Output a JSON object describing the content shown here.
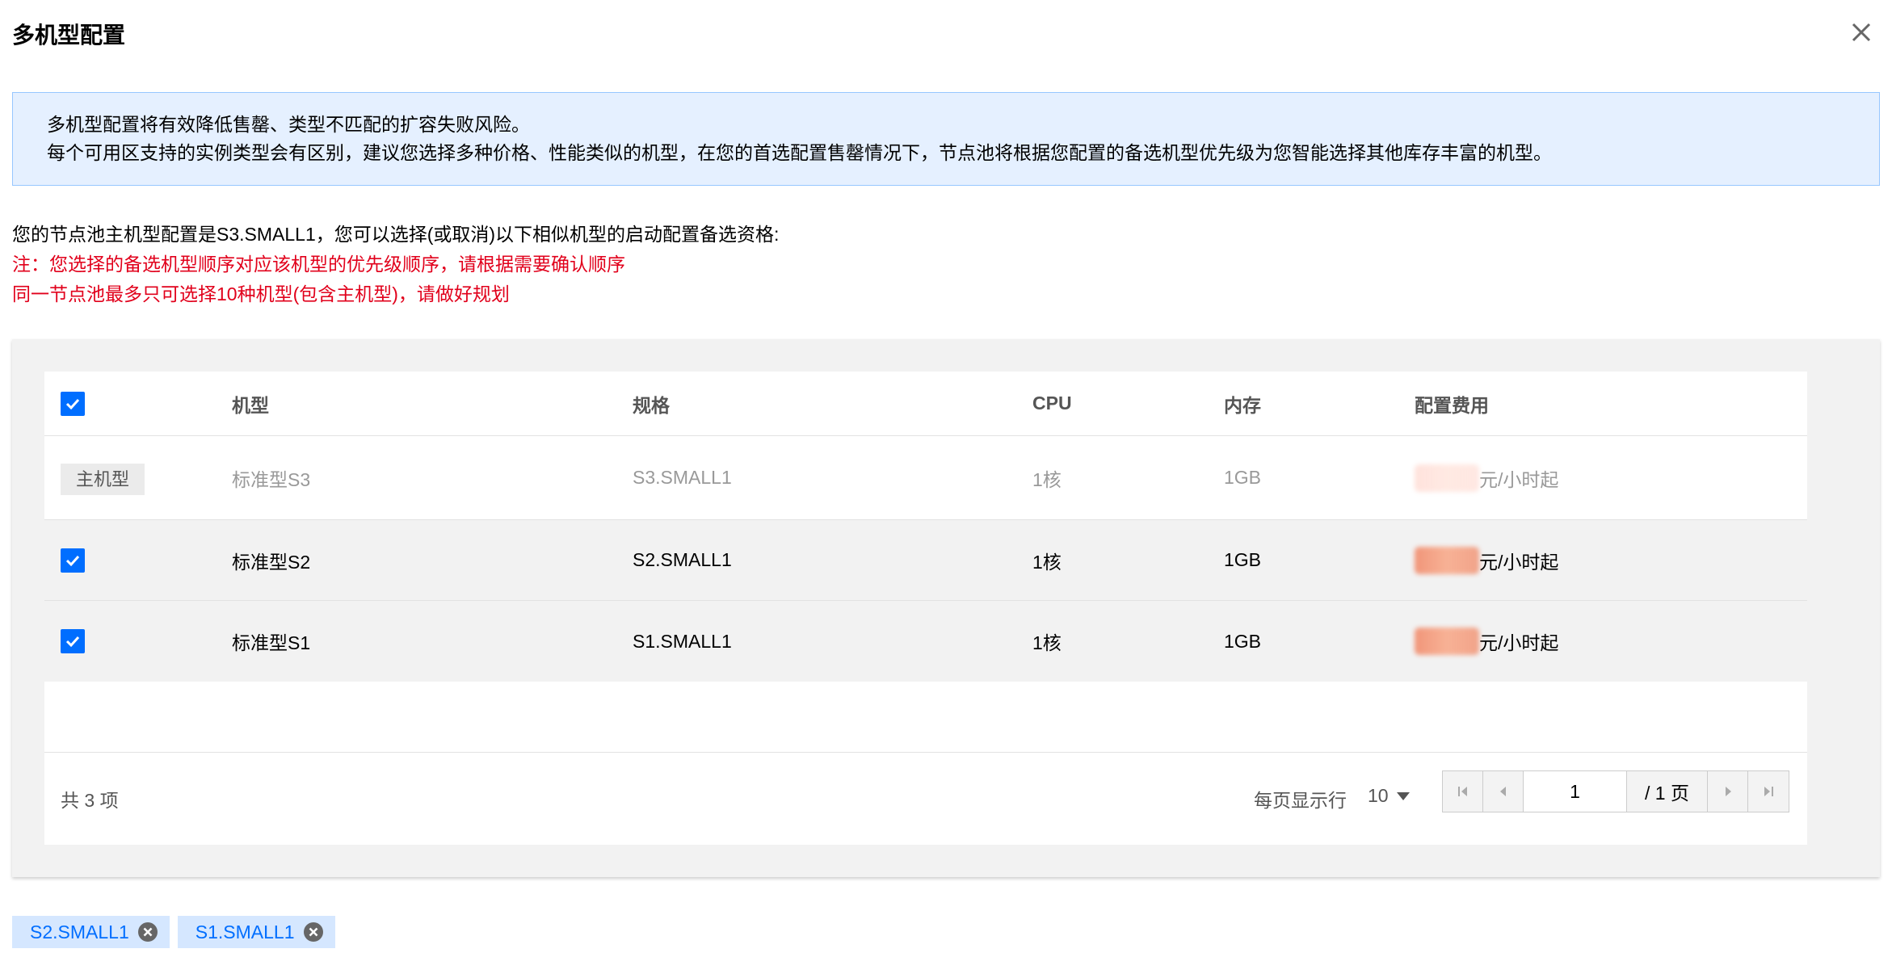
{
  "dialog": {
    "title": "多机型配置"
  },
  "info": {
    "line1": "多机型配置将有效降低售罄、类型不匹配的扩容失败风险。",
    "line2": "每个可用区支持的实例类型会有区别，建议您选择多种价格、性能类似的机型，在您的首选配置售罄情况下，节点池将根据您配置的备选机型优先级为您智能选择其他库存丰富的机型。"
  },
  "intro": {
    "line1": "您的节点池主机型配置是S3.SMALL1，您可以选择(或取消)以下相似机型的启动配置备选资格:",
    "note1": "注：您选择的备选机型顺序对应该机型的优先级顺序，请根据需要确认顺序",
    "note2": "同一节点池最多只可选择10种机型(包含主机型)，请做好规划"
  },
  "table": {
    "headers": {
      "model": "机型",
      "spec": "规格",
      "cpu": "CPU",
      "memory": "内存",
      "price": "配置费用"
    },
    "main_row": {
      "tag": "主机型",
      "model": "标准型S3",
      "spec": "S3.SMALL1",
      "cpu": "1核",
      "memory": "1GB",
      "price_suffix": "元/小时起"
    },
    "rows": [
      {
        "model": "标准型S2",
        "spec": "S2.SMALL1",
        "cpu": "1核",
        "memory": "1GB",
        "price_suffix": "元/小时起",
        "checked": true
      },
      {
        "model": "标准型S1",
        "spec": "S1.SMALL1",
        "cpu": "1核",
        "memory": "1GB",
        "price_suffix": "元/小时起",
        "checked": true
      }
    ]
  },
  "pagination": {
    "total_text": "共 3 项",
    "page_size_label": "每页显示行",
    "page_size": "10",
    "current_page": "1",
    "total_pages_text": "/ 1 页"
  },
  "selected_chips": [
    "S2.SMALL1",
    "S1.SMALL1"
  ],
  "colors": {
    "accent": "#006eff",
    "info_bg": "#e5f0ff",
    "warning": "#e1001b"
  }
}
